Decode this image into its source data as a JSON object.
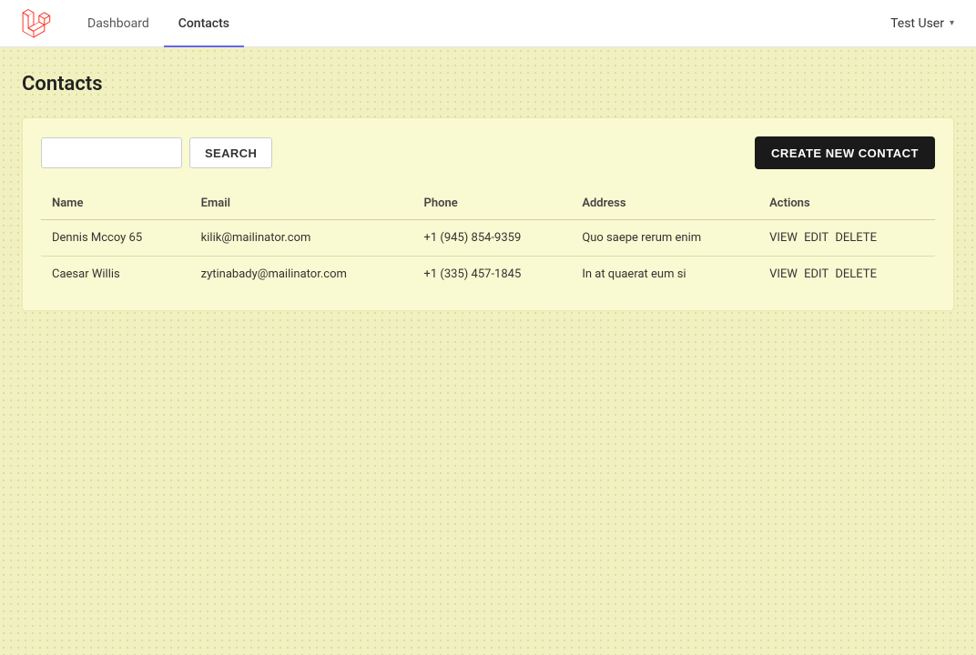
{
  "navbar": {
    "logo_alt": "Laravel Logo",
    "nav_links": [
      {
        "label": "Dashboard",
        "active": false,
        "id": "dashboard"
      },
      {
        "label": "Contacts",
        "active": true,
        "id": "contacts"
      }
    ],
    "user_name": "Test User"
  },
  "page": {
    "title": "Contacts"
  },
  "toolbar": {
    "search_placeholder": "",
    "search_button_label": "SEARCH",
    "create_button_label": "CREATE NEW CONTACT"
  },
  "table": {
    "columns": [
      "Name",
      "Email",
      "Phone",
      "Address",
      "Actions"
    ],
    "rows": [
      {
        "name": "Dennis Mccoy 65",
        "email": "kilik@mailinator.com",
        "phone": "+1 (945) 854-9359",
        "address": "Quo saepe rerum enim",
        "actions": [
          "VIEW",
          "EDIT",
          "DELETE"
        ]
      },
      {
        "name": "Caesar Willis",
        "email": "zytinabady@mailinator.com",
        "phone": "+1 (335) 457-1845",
        "address": "In at quaerat eum si",
        "actions": [
          "VIEW",
          "EDIT",
          "DELETE"
        ]
      }
    ]
  }
}
